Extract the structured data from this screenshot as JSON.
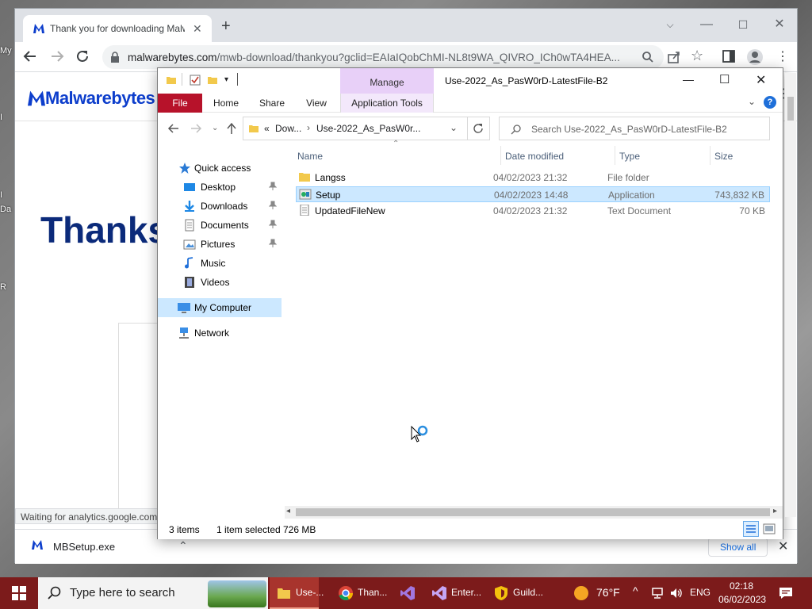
{
  "desktop": {
    "labels": [
      "My",
      "I",
      "I",
      "Da",
      "R"
    ]
  },
  "chrome": {
    "tab_title": "Thank you for downloading Malwarebytes",
    "url_domain": "malwarebytes.com",
    "url_path": "/mwb-download/thankyou?gclid=EAIaIQobChMI-NL8t9WA_QIVRO_ICh0wTA4HEA...",
    "logo_text": "Malwarebytes",
    "heading": "Thanks",
    "status_text": "Waiting for analytics.google.com...",
    "download_file": "MBSetup.exe",
    "show_all": "Show all"
  },
  "explorer": {
    "title": "Use-2022_As_PasW0rD-LatestFile-B2",
    "context_tab": "Manage",
    "ribbon_tabs": {
      "file": "File",
      "home": "Home",
      "share": "Share",
      "view": "View",
      "app_tools": "Application Tools"
    },
    "breadcrumb": {
      "prefix": "«",
      "part1": "Dow...",
      "part2": "Use-2022_As_PasW0r..."
    },
    "search_placeholder": "Search Use-2022_As_PasW0rD-LatestFile-B2",
    "nav": {
      "quick_access": "Quick access",
      "desktop": "Desktop",
      "downloads": "Downloads",
      "documents": "Documents",
      "pictures": "Pictures",
      "music": "Music",
      "videos": "Videos",
      "my_computer": "My Computer",
      "network": "Network"
    },
    "columns": {
      "name": "Name",
      "date": "Date modified",
      "type": "Type",
      "size": "Size"
    },
    "files": [
      {
        "name": "Langss",
        "date": "04/02/2023 21:32",
        "type": "File folder",
        "size": ""
      },
      {
        "name": "Setup",
        "date": "04/02/2023 14:48",
        "type": "Application",
        "size": "743,832 KB"
      },
      {
        "name": "UpdatedFileNew",
        "date": "04/02/2023 21:32",
        "type": "Text Document",
        "size": "70 KB"
      }
    ],
    "status": {
      "items": "3 items",
      "selected": "1 item selected",
      "size": "726 MB"
    }
  },
  "taskbar": {
    "search_placeholder": "Type here to search",
    "apps": {
      "explorer": "Use-...",
      "chrome": "Than...",
      "enter": "Enter...",
      "guild": "Guild..."
    },
    "weather": "76°F",
    "lang": "ENG",
    "time": "02:18",
    "date": "06/02/2023"
  },
  "colors": {
    "accent": "#0d3ecc",
    "taskbar": "#7c1b1b",
    "file_tab": "#b7122a",
    "selection": "#cce8ff"
  }
}
